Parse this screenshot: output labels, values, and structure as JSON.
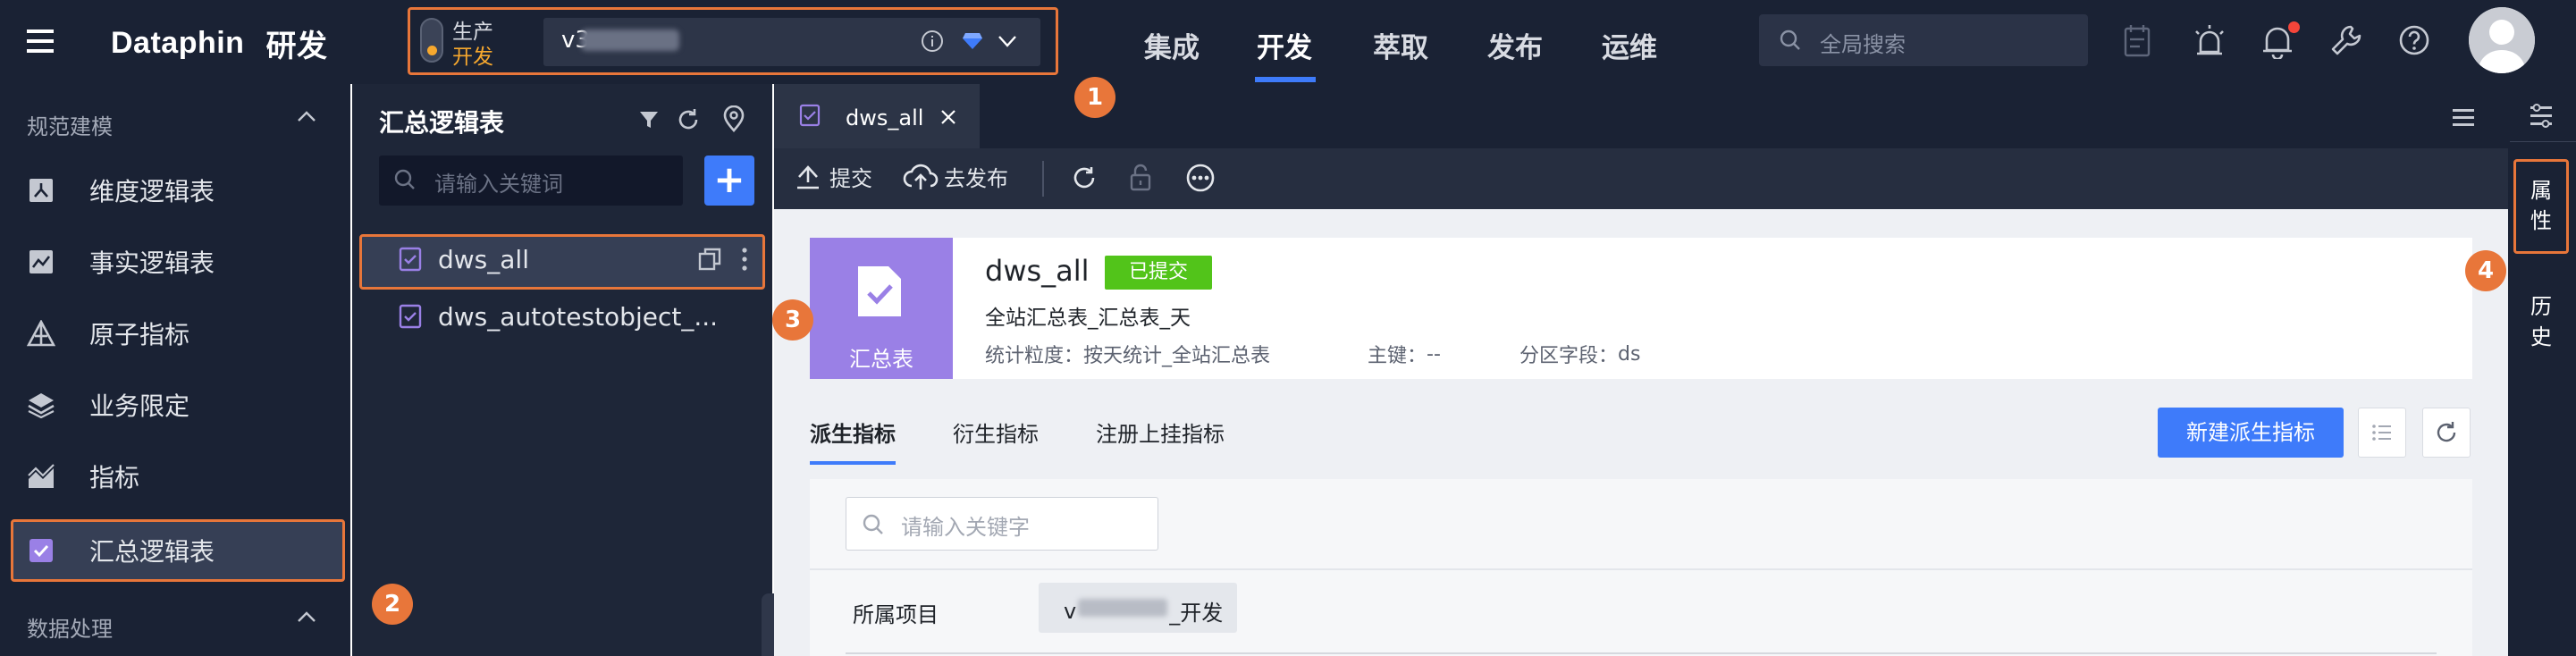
{
  "topbar": {
    "logo_text": "Dataphin",
    "module": "研发",
    "env": {
      "prod_label": "生产",
      "dev_label": "开发"
    },
    "project_name": "v3",
    "nav": [
      "集成",
      "开发",
      "萃取",
      "发布",
      "运维"
    ],
    "active_nav": "开发",
    "search_placeholder": "全局搜索"
  },
  "sidebar": {
    "section1": "规范建模",
    "items": [
      "维度逻辑表",
      "事实逻辑表",
      "原子指标",
      "业务限定",
      "指标",
      "汇总逻辑表"
    ],
    "active_item": "汇总逻辑表",
    "section2": "数据处理"
  },
  "panel": {
    "title": "汇总逻辑表",
    "search_placeholder": "请输入关键词",
    "add_label": "+",
    "items": [
      "dws_all",
      "dws_autotestobject_..."
    ]
  },
  "editor": {
    "tab_label": "dws_all",
    "toolbar": {
      "submit": "提交",
      "publish": "去发布"
    },
    "card": {
      "icon_label": "汇总表",
      "title": "dws_all",
      "status": "已提交",
      "description": "全站汇总表_汇总表_天",
      "granularity_label": "统计粒度：",
      "granularity_value": "按天统计_全站汇总表",
      "pk_label": "主键：",
      "pk_value": "--",
      "partition_label": "分区字段：",
      "partition_value": "ds"
    },
    "inner_tabs": [
      "派生指标",
      "衍生指标",
      "注册上挂指标"
    ],
    "new_button": "新建派生指标",
    "content_search_placeholder": "请输入关键字",
    "project_label": "所属项目",
    "project_chip_prefix": "v",
    "project_chip_suffix": "_开发"
  },
  "right_strip": {
    "attr": [
      "属",
      "性"
    ],
    "history": [
      "历",
      "史"
    ]
  },
  "callouts": [
    "1",
    "2",
    "3",
    "4"
  ],
  "colors": {
    "accent": "#3e7bfa",
    "highlight": "#e8763a",
    "env_dev": "#f7a82e",
    "success": "#52c41a",
    "card_icon": "#9a80e6"
  }
}
